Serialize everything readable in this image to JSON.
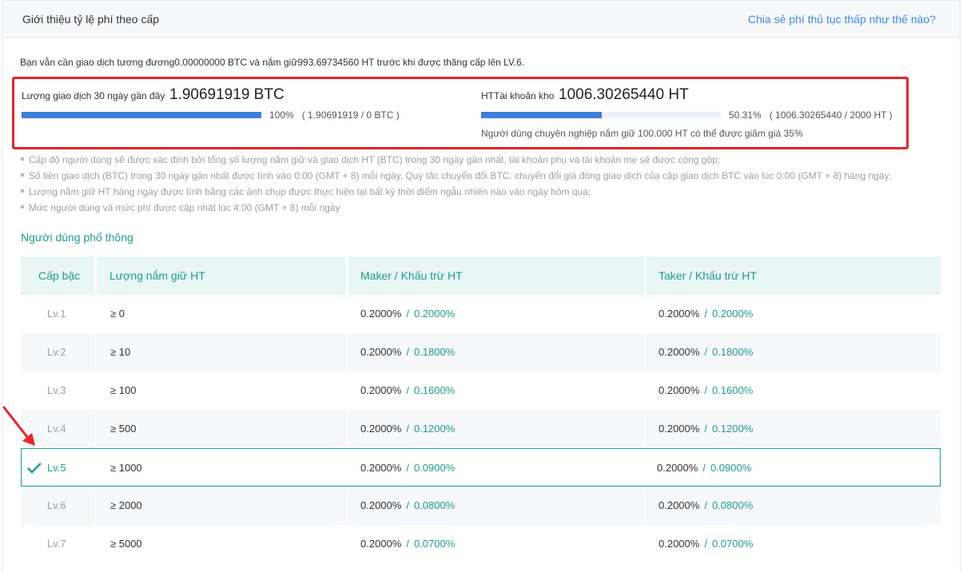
{
  "header": {
    "title": "Giới thiệu tỷ lệ phí theo cấp",
    "link": "Chia sẻ phí thủ tục thấp như thế nào?"
  },
  "notice": "Bạn vẫn cần giao dịch tương đương0.00000000 BTC và nắm giữ993.69734560 HT trước khi được thăng cấp lên LV.6.",
  "volume": {
    "label": "Lượng giao dịch 30 ngày gần đây",
    "value": "1.90691919 BTC",
    "progress": 1.0,
    "progress_text": "100%   ( 1.90691919 / 0 BTC )"
  },
  "holding": {
    "label": "HTTài khoản kho",
    "value": "1006.30265440 HT",
    "progress": 0.5031,
    "progress_text": "50.31%   ( 1006.30265440 / 2000 HT )",
    "note": "Người dùng chuyên nghiệp nắm giữ 100.000 HT có thể được giảm giá 35%"
  },
  "notes": [
    "Cấp độ người dùng sẽ được xác định bởi tổng số lượng nắm giữ và giao dịch HT (BTC) trong 30 ngày gần nhất, tài khoản phụ và tài khoản mẹ sẽ được cộng gộp;",
    "Số tiền giao dịch (BTC) trong 30 ngày gần nhất được tính vào 0:00 (GMT + 8) mỗi ngày. Quy tắc chuyển đổi BTC: chuyển đổi giá đóng giao dịch của cặp giao dịch BTC vào lúc 0:00 (GMT + 8) hàng ngày;",
    "Lượng nắm giữ HT hàng ngày được tính bằng các ảnh chụp được thực hiện tại bất kỳ thời điểm ngẫu nhiên nào vào ngày hôm qua;",
    "Mức người dùng và mức phí được cập nhật lúc 4:00 (GMT + 8) mỗi ngày"
  ],
  "section_title": "Người dùng phổ thông",
  "table": {
    "headers": [
      "Cấp bậc",
      "Lượng nắm giữ HT",
      "Maker / Khấu trừ HT",
      "Taker / Khấu trừ HT"
    ],
    "rows": [
      {
        "level": "Lv.1",
        "hold": "≥ 0",
        "maker": "0.2000%",
        "maker_disc": "0.2000%",
        "taker": "0.2000%",
        "taker_disc": "0.2000%"
      },
      {
        "level": "Lv.2",
        "hold": "≥ 10",
        "maker": "0.2000%",
        "maker_disc": "0.1800%",
        "taker": "0.2000%",
        "taker_disc": "0.1800%"
      },
      {
        "level": "Lv.3",
        "hold": "≥ 100",
        "maker": "0.2000%",
        "maker_disc": "0.1600%",
        "taker": "0.2000%",
        "taker_disc": "0.1600%"
      },
      {
        "level": "Lv.4",
        "hold": "≥ 500",
        "maker": "0.2000%",
        "maker_disc": "0.1200%",
        "taker": "0.2000%",
        "taker_disc": "0.1200%"
      },
      {
        "level": "Lv.5",
        "hold": "≥ 1000",
        "maker": "0.2000%",
        "maker_disc": "0.0900%",
        "taker": "0.2000%",
        "taker_disc": "0.0900%"
      },
      {
        "level": "Lv.6",
        "hold": "≥ 2000",
        "maker": "0.2000%",
        "maker_disc": "0.0800%",
        "taker": "0.2000%",
        "taker_disc": "0.0800%"
      },
      {
        "level": "Lv.7",
        "hold": "≥ 5000",
        "maker": "0.2000%",
        "maker_disc": "0.0700%",
        "taker": "0.2000%",
        "taker_disc": "0.0700%"
      }
    ],
    "active_level": "Lv.5",
    "slash": "/"
  },
  "colors": {
    "accent": "#1d9e8a",
    "link": "#3d8af5",
    "bar": "#3b7fd9",
    "highlight": "#e8242a"
  },
  "icons": {
    "active_marker": "check-icon",
    "annotation": "red-arrow-icon"
  }
}
